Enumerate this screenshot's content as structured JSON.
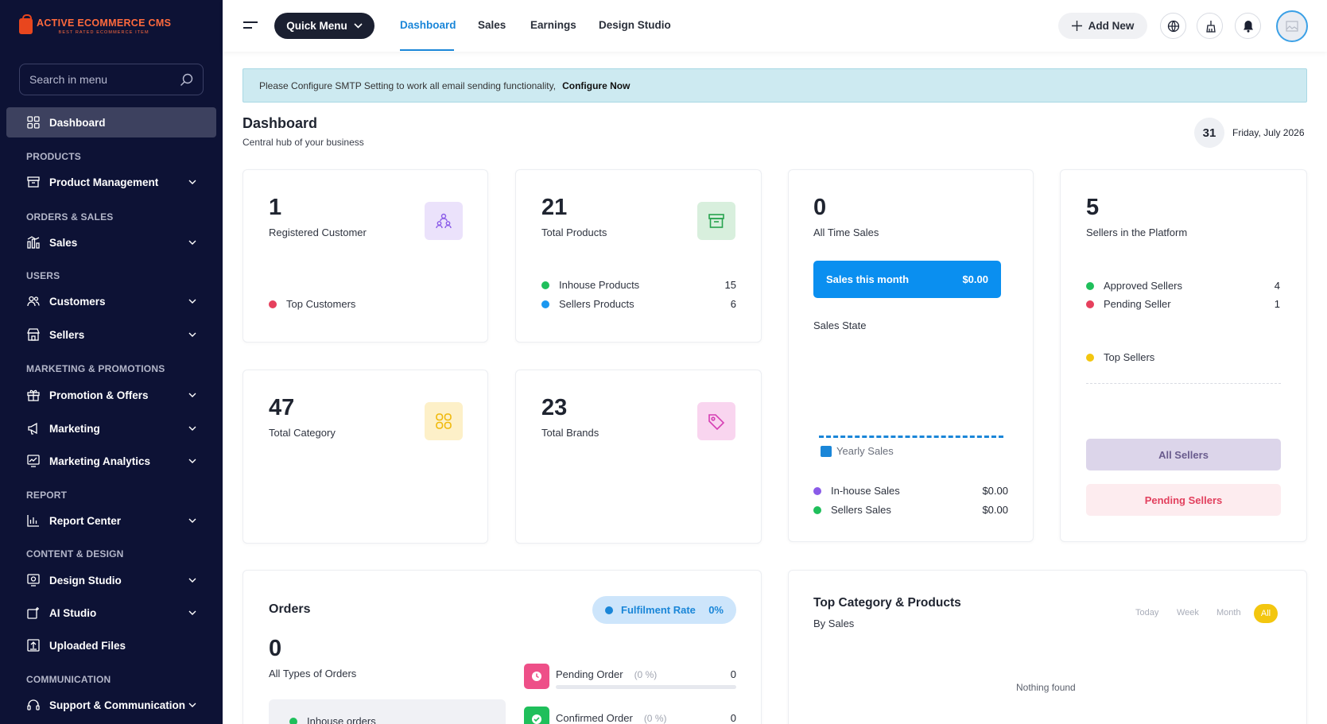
{
  "brand": {
    "title": "ACTIVE ECOMMERCE CMS",
    "tagline": "BEST RATED ECOMMERCE ITEM"
  },
  "sidebar": {
    "search_placeholder": "Search in menu",
    "dashboard_label": "Dashboard",
    "sections": {
      "products": "PRODUCTS",
      "orders": "ORDERS & SALES",
      "users": "USERS",
      "marketing": "MARKETING & PROMOTIONS",
      "report": "REPORT",
      "content": "CONTENT & DESIGN",
      "communication": "COMMUNICATION"
    },
    "items": {
      "product_management": "Product Management",
      "sales": "Sales",
      "customers": "Customers",
      "sellers": "Sellers",
      "promotion": "Promotion & Offers",
      "marketing": "Marketing",
      "marketing_analytics": "Marketing Analytics",
      "report_center": "Report Center",
      "design_studio": "Design Studio",
      "ai_studio": "AI Studio",
      "uploaded_files": "Uploaded Files",
      "support": "Support & Communication"
    }
  },
  "topbar": {
    "quick_menu": "Quick Menu",
    "nav": [
      "Dashboard",
      "Sales",
      "Earnings",
      "Design Studio"
    ],
    "add_new": "Add New"
  },
  "alert": {
    "text": "Please Configure SMTP Setting to work all email sending functionality,",
    "link": "Configure Now"
  },
  "page": {
    "title": "Dashboard",
    "subtitle": "Central hub of your business",
    "day": "31",
    "date": "Friday, July 2026"
  },
  "customers_card": {
    "value": "1",
    "label": "Registered Customer",
    "top_label": "Top Customers"
  },
  "products_card": {
    "value": "21",
    "label": "Total Products",
    "inhouse_label": "Inhouse Products",
    "inhouse_value": "15",
    "sellers_label": "Sellers Products",
    "sellers_value": "6"
  },
  "sales_card": {
    "value": "0",
    "label": "All Time Sales",
    "month_label": "Sales this month",
    "month_value": "$0.00",
    "state_label": "Sales State",
    "legend": "Yearly Sales",
    "inhouse_label": "In-house Sales",
    "inhouse_value": "$0.00",
    "sellers_label": "Sellers Sales",
    "sellers_value": "$0.00"
  },
  "sellers_card": {
    "value": "5",
    "label": "Sellers in the Platform",
    "approved_label": "Approved Sellers",
    "approved_value": "4",
    "pending_label": "Pending Seller",
    "pending_value": "1",
    "top_label": "Top Sellers",
    "all_button": "All Sellers",
    "pending_button": "Pending Sellers"
  },
  "category_card": {
    "value": "47",
    "label": "Total Category"
  },
  "brands_card": {
    "value": "23",
    "label": "Total Brands"
  },
  "orders_card": {
    "title": "Orders",
    "fulfil_label": "Fulfilment Rate",
    "fulfil_value": "0%",
    "value": "0",
    "label": "All Types of Orders",
    "inhouse_label": "Inhouse orders",
    "pending_label": "Pending Order",
    "pending_pct": "(0 %)",
    "pending_value": "0",
    "confirmed_label": "Confirmed Order",
    "confirmed_pct": "(0 %)",
    "confirmed_value": "0"
  },
  "top_category_card": {
    "title": "Top Category & Products",
    "subtitle": "By Sales",
    "filters": [
      "Today",
      "Week",
      "Month",
      "All"
    ],
    "empty": "Nothing found"
  },
  "colors": {
    "sidebar_bg": "#0d1235",
    "accent": "#1a86d8",
    "sales_button": "#0a8ff0",
    "green": "#1fbf5b",
    "red": "#e6405d",
    "blue": "#1a98f0",
    "purple": "#8a5be8",
    "yellow": "#f3c60f"
  }
}
